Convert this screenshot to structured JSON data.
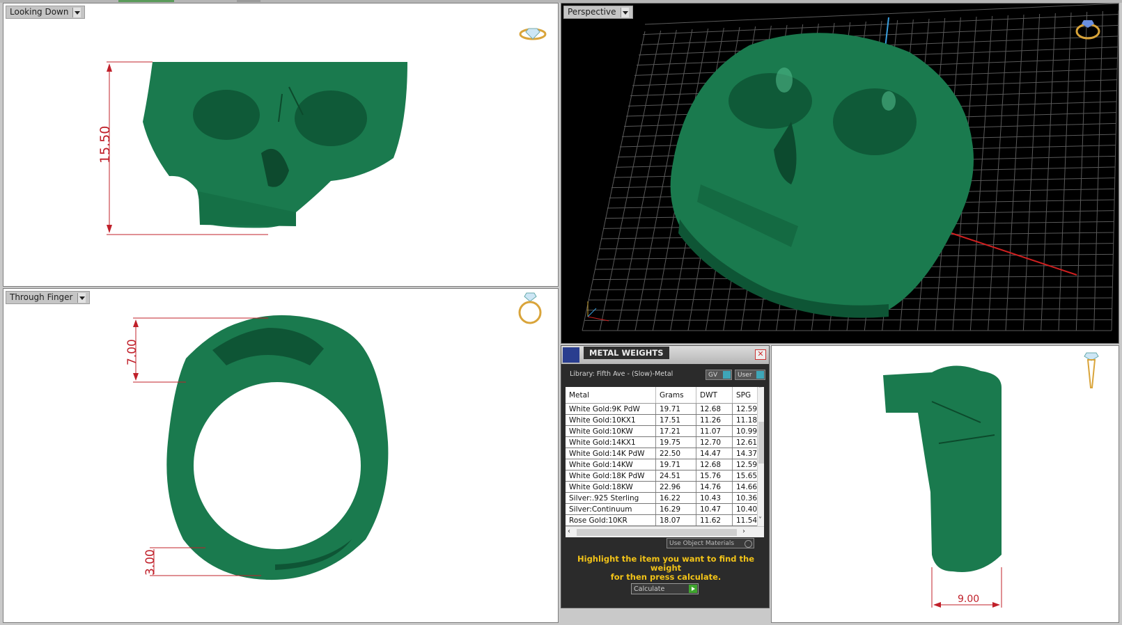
{
  "viewports": {
    "looking_down": {
      "label": "Looking Down",
      "dimension": "15.50"
    },
    "perspective": {
      "label": "Perspective"
    },
    "through_finger": {
      "label": "Through Finger",
      "dimension_top": "7.00",
      "dimension_bottom": "3.00"
    },
    "side": {
      "dimension": "9.00"
    }
  },
  "metal_weights": {
    "title": "METAL WEIGHTS",
    "library": "Library: Fifth Ave - (Slow)-Metal",
    "gv_label": "GV",
    "user_label": "User",
    "close_icon": "close-icon",
    "columns": [
      "Metal",
      "Grams",
      "DWT",
      "SPG"
    ],
    "rows": [
      {
        "metal": "White Gold:9K PdW",
        "grams": "19.71",
        "dwt": "12.68",
        "spg": "12.59"
      },
      {
        "metal": "White Gold:10KX1",
        "grams": "17.51",
        "dwt": "11.26",
        "spg": "11.18"
      },
      {
        "metal": "White Gold:10KW",
        "grams": "17.21",
        "dwt": "11.07",
        "spg": "10.99"
      },
      {
        "metal": "White Gold:14KX1",
        "grams": "19.75",
        "dwt": "12.70",
        "spg": "12.61"
      },
      {
        "metal": "White Gold:14K PdW",
        "grams": "22.50",
        "dwt": "14.47",
        "spg": "14.37"
      },
      {
        "metal": "White Gold:14KW",
        "grams": "19.71",
        "dwt": "12.68",
        "spg": "12.59"
      },
      {
        "metal": "White Gold:18K PdW",
        "grams": "24.51",
        "dwt": "15.76",
        "spg": "15.65"
      },
      {
        "metal": "White Gold:18KW",
        "grams": "22.96",
        "dwt": "14.76",
        "spg": "14.66"
      },
      {
        "metal": "Silver:.925 Sterling",
        "grams": "16.22",
        "dwt": "10.43",
        "spg": "10.36"
      },
      {
        "metal": "Silver:Continuum",
        "grams": "16.29",
        "dwt": "10.47",
        "spg": "10.40"
      },
      {
        "metal": "Rose Gold:10KR",
        "grams": "18.07",
        "dwt": "11.62",
        "spg": "11.54"
      }
    ],
    "use_object_materials": "Use Object Materials",
    "hint_line1": "Highlight the item you want to find the weight",
    "hint_line2": "for then press calculate.",
    "calculate_label": "Calculate"
  },
  "colors": {
    "model_green": "#1a7a4e",
    "dimension_red": "#c0202a",
    "hint_yellow": "#f2c318"
  }
}
